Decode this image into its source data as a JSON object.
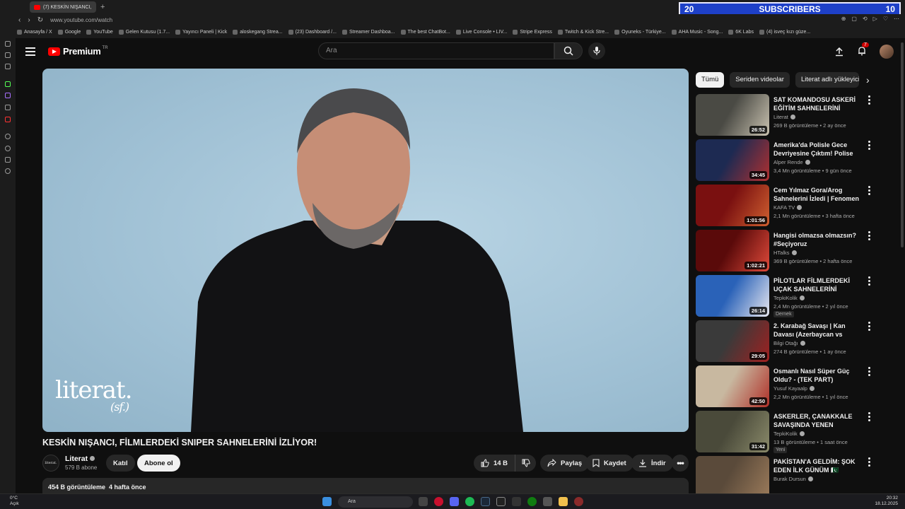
{
  "browser": {
    "tab_title": "(7) KESKİN NIŞANCI,",
    "url": "www.youtube.com/watch",
    "bookmarks": [
      "Anasayfa / X",
      "Google",
      "YouTube",
      "Gelen Kutusu (1.7...",
      "Yayıncı Paneli | Kick",
      "aloskegang Strea...",
      "(23) Dashboard /...",
      "Streamer Dashboa...",
      "The best ChatBot...",
      "Live Console • LIV...",
      "Stripe Express",
      "Twitch & Kick Stre...",
      "Oyuneks - Türkiye...",
      "AHA Music - Song...",
      "6K Labs",
      "(4) isveç kızı güze..."
    ]
  },
  "overlay": {
    "left_count": "20",
    "label": "SUBSCRIBERS",
    "right_count": "10"
  },
  "header": {
    "logo_text": "Premium",
    "logo_region": "TR",
    "search_placeholder": "Ara",
    "notification_count": "7"
  },
  "video": {
    "title": "KESKİN NIŞANCI, FİLMLERDEKİ SNIPER SAHNELERİNİ İZLİYOR!",
    "watermark": "literat.",
    "watermark_sub": "(sf.)",
    "channel_name": "Literat",
    "channel_avatar_text": "literat.",
    "subscribers": "579 B abone",
    "join_label": "Katıl",
    "subscribe_label": "Abone ol",
    "likes": "14 B",
    "share_label": "Paylaş",
    "save_label": "Kaydet",
    "download_label": "İndir",
    "views": "454 B görüntüleme",
    "published": "4 hafta önce"
  },
  "chips": [
    "Tümü",
    "Seriden videolar",
    "Literat adlı yükleyicid"
  ],
  "related": [
    {
      "title": "SAT KOMANDOSU ASKERİ EĞİTİM SAHNELERİNİ İZLİYOR!",
      "channel": "Literat",
      "meta": "269 B görüntüleme • 2 ay önce",
      "duration": "26:52",
      "badge": "",
      "c1": "#4a4a44",
      "c2": "#c9c2b0"
    },
    {
      "title": "Amerika'da Polisle Gece Devriyesine Çıktım! Polise Küf...",
      "channel": "Alper Rende",
      "meta": "3,4 Mn görüntüleme • 9 gün önce",
      "duration": "34:45",
      "badge": "",
      "c1": "#1d2a52",
      "c2": "#b03030"
    },
    {
      "title": "Cem Yılmaz Gora/Arog Sahnelerini İzledi | Fenomen ...",
      "channel": "KAFA TV",
      "meta": "2,1 Mn görüntüleme • 3 hafta önce",
      "duration": "1:01:56",
      "badge": "",
      "c1": "#7a1010",
      "c2": "#d06030"
    },
    {
      "title": "Hangisi olmazsa olmazsın? #Seçiyoruz",
      "channel": "HTalks",
      "meta": "369 B görüntüleme • 2 hafta önce",
      "duration": "1:02:21",
      "badge": "",
      "c1": "#5a0a0a",
      "c2": "#e04a3a"
    },
    {
      "title": "PİLOTLAR FİLMLERDEKİ UÇAK SAHNELERİNİ İZLİYOR!",
      "channel": "TepkiKolik",
      "meta": "2,4 Mn görüntüleme • 2 yıl önce",
      "duration": "26:14",
      "badge": "Dernek",
      "c1": "#2a62b8",
      "c2": "#e8e8f0"
    },
    {
      "title": "2. Karabağ Savaşı | Kan Davası (Azerbaycan vs Ermenistan)",
      "channel": "Bilgi Otağı",
      "meta": "274 B görüntüleme • 1 ay önce",
      "duration": "29:05",
      "badge": "",
      "c1": "#3a3a3a",
      "c2": "#a02020"
    },
    {
      "title": "Osmanlı Nasıl Süper Güç Oldu? - (TEK PART)",
      "channel": "Yusuf Kayaalp",
      "meta": "2,2 Mn görüntüleme • 1 yıl önce",
      "duration": "42:50",
      "badge": "",
      "c1": "#c8b8a0",
      "c2": "#b03028"
    },
    {
      "title": "ASKERLER, ÇANAKKALE SAVAŞINDA YENEN YEMEKLE...",
      "channel": "TepkiKolik",
      "meta": "13 B görüntüleme • 1 saat önce",
      "duration": "31:42",
      "badge": "Yeni",
      "c1": "#4a4a3a",
      "c2": "#8a8a6a"
    },
    {
      "title": "PAKİSTAN'A GELDİM: ŞOK EDEN İLK GÜNÜM 🇵🇰",
      "channel": "Burak Dursun",
      "meta": "",
      "duration": "",
      "badge": "",
      "c1": "#5a4a3a",
      "c2": "#9a7a5a"
    }
  ],
  "taskbar": {
    "temperature": "0°C",
    "weather_text": "Açık",
    "search_label": "Ara",
    "time": "20:32",
    "date": "18.12.2025"
  }
}
